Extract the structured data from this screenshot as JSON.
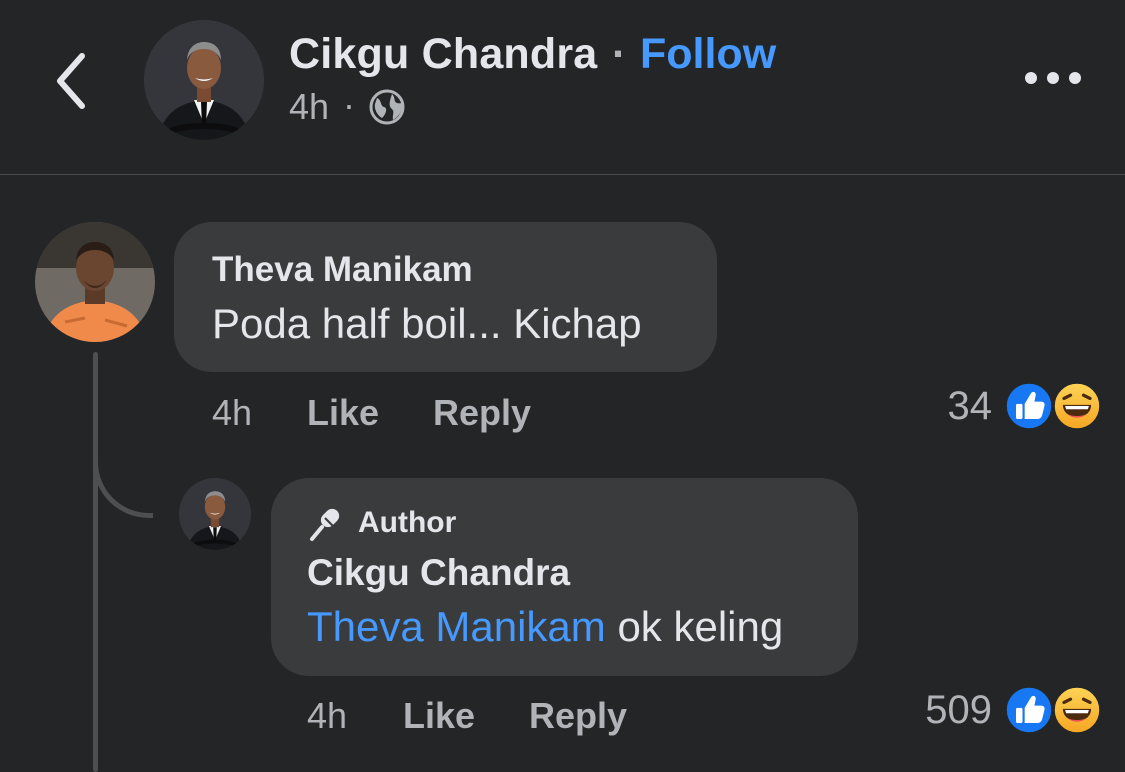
{
  "post": {
    "author": "Cikgu Chandra",
    "separator": "·",
    "follow_label": "Follow",
    "time": "4h",
    "meta_separator": "·",
    "privacy_icon": "globe-icon"
  },
  "comments": [
    {
      "author": "Theva Manikam",
      "text": "Poda half boil... Kichap",
      "time": "4h",
      "like_label": "Like",
      "reply_label": "Reply",
      "reaction_count": "34",
      "reactions": [
        "like-reaction-icon",
        "haha-reaction-icon"
      ],
      "replies": [
        {
          "badge_icon": "microphone-icon",
          "badge": "Author",
          "author": "Cikgu Chandra",
          "mention": "Theva Manikam",
          "text": " ok keling",
          "time": "4h",
          "like_label": "Like",
          "reply_label": "Reply",
          "reaction_count": "509",
          "reactions": [
            "like-reaction-icon",
            "haha-reaction-icon"
          ]
        }
      ]
    }
  ],
  "colors": {
    "background": "#242526",
    "bubble": "#3a3b3c",
    "link": "#4599ff",
    "text_primary": "#e4e6eb",
    "text_secondary": "#b0b3b8",
    "like_blue": "#1877f2",
    "haha_yellow": "#f7b928"
  }
}
